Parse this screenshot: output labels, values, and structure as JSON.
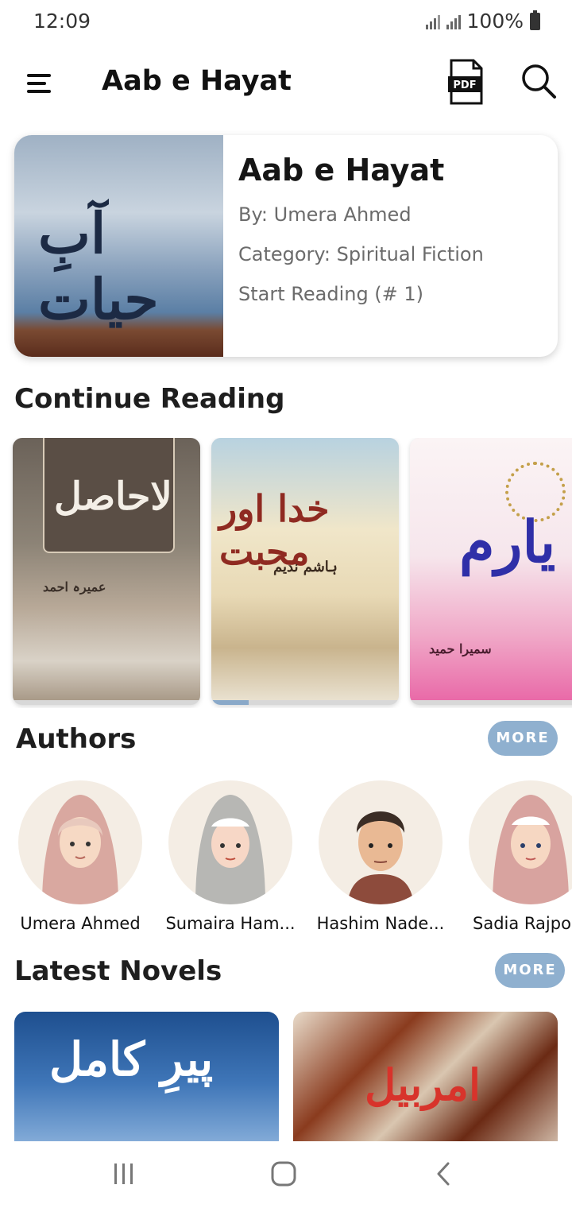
{
  "status": {
    "time": "12:09",
    "battery": "100%"
  },
  "toolbar": {
    "title": "Aab e Hayat",
    "pdf_label": "PDF"
  },
  "featured": {
    "cover_text": "آبِ حیات",
    "title": "Aab e Hayat",
    "author": "By: Umera Ahmed",
    "category": "Category: Spiritual Fiction",
    "start": "Start Reading (# 1)"
  },
  "continue_reading": {
    "heading": "Continue Reading",
    "books": [
      {
        "cover_text": "لاحاصل",
        "author_text": "عمیرہ احمد",
        "progress": 0
      },
      {
        "cover_text": "خدا اور محبت",
        "author_text": "ہاشم ندیم",
        "progress": 0.2
      },
      {
        "cover_text": "یارم",
        "author_text": "سمیرا حمید",
        "progress": 0
      }
    ]
  },
  "authors": {
    "heading": "Authors",
    "more_label": "MORE",
    "items": [
      {
        "name": "Umera Ahmed",
        "avatar": "female-hijab-avatar"
      },
      {
        "name": "Sumaira Ham...",
        "avatar": "female-hijab-avatar"
      },
      {
        "name": "Hashim Nade...",
        "avatar": "male-avatar"
      },
      {
        "name": "Sadia Rajpo",
        "avatar": "female-hijab-avatar"
      }
    ]
  },
  "latest_novels": {
    "heading": "Latest Novels",
    "more_label": "MORE",
    "items": [
      {
        "cover_text": "پیرِ کامل"
      },
      {
        "cover_text": "امربیل"
      }
    ]
  },
  "colors": {
    "accent": "#8fb0cf",
    "text_primary": "#1a1a1a",
    "text_secondary": "#6b6b6b"
  }
}
